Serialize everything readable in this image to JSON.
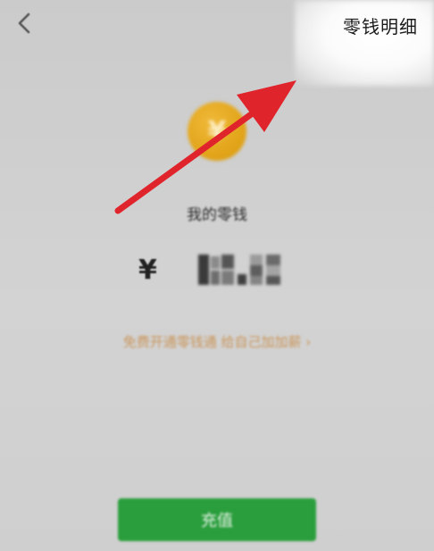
{
  "header": {
    "back_icon": "chevron-left-icon",
    "detail_label": "零钱明细"
  },
  "wallet": {
    "coin_icon": "yuan-coin-icon",
    "coin_symbol": "¥",
    "coin_color": "#e2a51a",
    "title": "我的零钱",
    "currency_symbol": "¥"
  },
  "promo": {
    "label": "免费开通零钱通 给自己加加薪 ›",
    "color": "#c9955a"
  },
  "actions": {
    "recharge_label": "充值",
    "recharge_color": "#2a9e3c"
  },
  "annotation": {
    "arrow_color": "#e0242c"
  }
}
